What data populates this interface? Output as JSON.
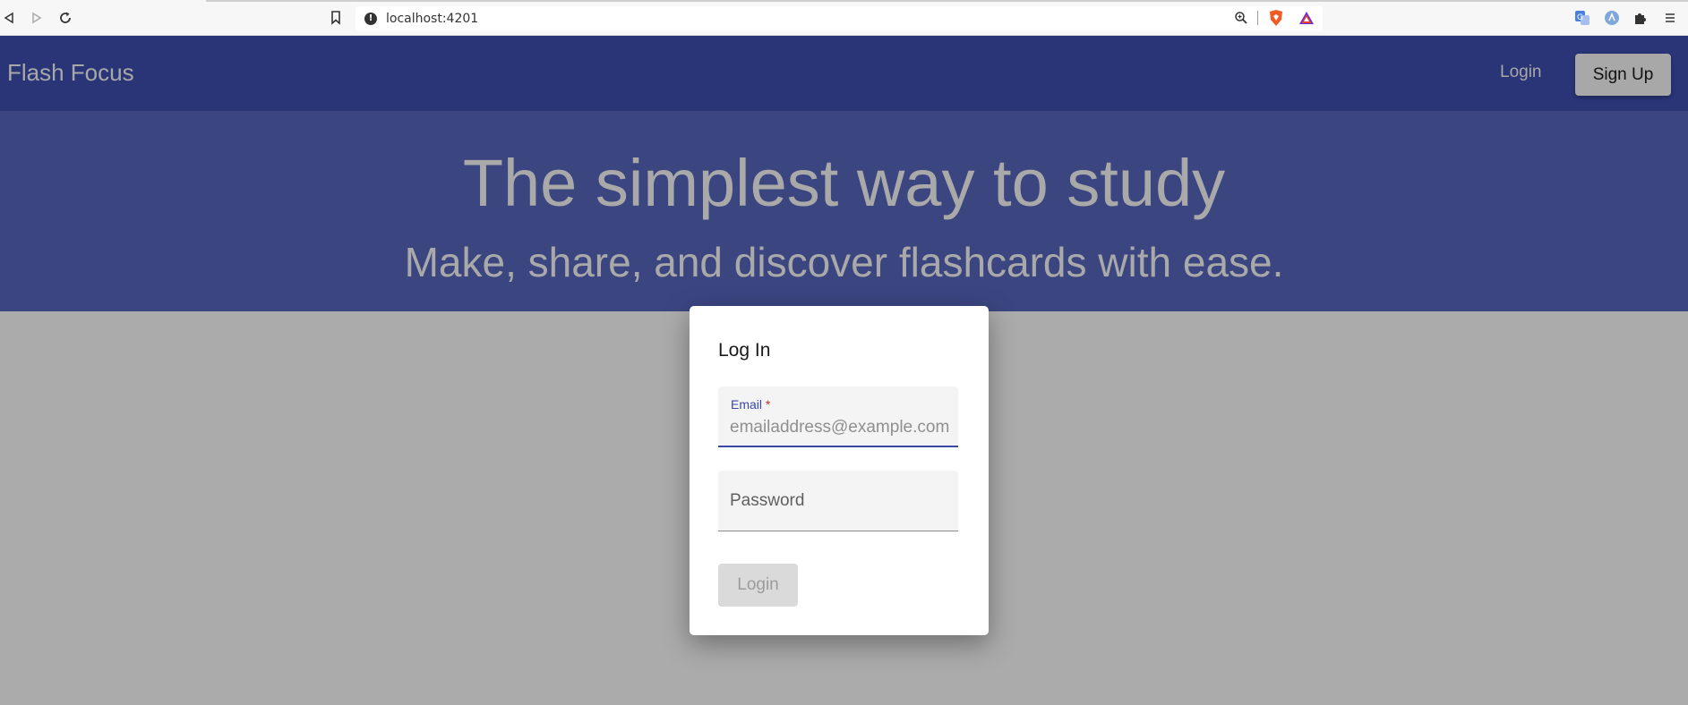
{
  "browser": {
    "url": "localhost:4201",
    "icons": [
      "back-icon",
      "forward-icon",
      "reload-icon",
      "bookmark-icon",
      "info-icon",
      "zoom-icon",
      "brave-shield-icon",
      "brave-rewards-icon",
      "translate-icon",
      "extension-icon",
      "puzzle-icon",
      "menu-icon"
    ]
  },
  "header": {
    "brand": "Flash Focus",
    "login_label": "Login",
    "signup_label": "Sign Up"
  },
  "hero": {
    "title": "The simplest way to study",
    "subtitle": "Make, share, and discover flashcards with ease."
  },
  "dialog": {
    "title": "Log In",
    "email_label": "Email",
    "email_required": "*",
    "email_placeholder": "emailaddress@example.com",
    "password_placeholder": "Password",
    "login_button": "Login"
  },
  "colors": {
    "header_bg": "#293577",
    "hero_bg": "#3b4580",
    "accent": "#3a48a8",
    "backdrop": "#ababab"
  }
}
